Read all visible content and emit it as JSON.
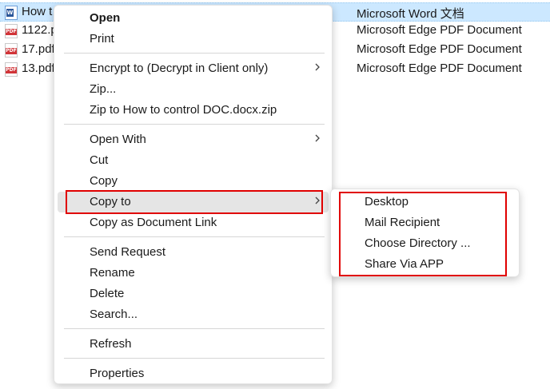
{
  "files": [
    {
      "name": "How t",
      "type": "Microsoft Word 文档",
      "icon": "word-doc-icon",
      "selected": true
    },
    {
      "name": "1122.p",
      "type": "Microsoft Edge PDF Document",
      "icon": "pdf-icon"
    },
    {
      "name": "17.pdf",
      "type": "Microsoft Edge PDF Document",
      "icon": "pdf-icon"
    },
    {
      "name": "13.pdf",
      "type": "Microsoft Edge PDF Document",
      "icon": "pdf-icon"
    }
  ],
  "icon_labels": {
    "pdf": "PDF",
    "word": "W"
  },
  "menu": {
    "open": "Open",
    "print": "Print",
    "encrypt": "Encrypt to (Decrypt in Client only)",
    "zip": "Zip...",
    "zip_to": "Zip to How to control DOC.docx.zip",
    "open_with": "Open With",
    "cut": "Cut",
    "copy": "Copy",
    "copy_to": "Copy to",
    "copy_link": "Copy as Document Link",
    "send_request": "Send Request",
    "rename": "Rename",
    "delete": "Delete",
    "search": "Search...",
    "refresh": "Refresh",
    "properties": "Properties"
  },
  "submenu": {
    "desktop": "Desktop",
    "mail": "Mail Recipient",
    "choose_dir": "Choose Directory ...",
    "share_app": "Share Via APP"
  },
  "colors": {
    "annotation": "#e00000",
    "highlight": "#e5e5e5",
    "selection": "#cce8ff"
  }
}
